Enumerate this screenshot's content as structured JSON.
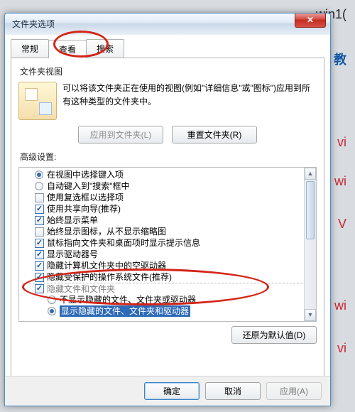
{
  "bg": {
    "t1": "win1(",
    "t2": "教",
    "t3": "vi",
    "t4": "wi",
    "t5": "V",
    "t6": "wi",
    "t7": "vi"
  },
  "dialog": {
    "title": "文件夹选项",
    "tabs": [
      "常规",
      "查看",
      "搜索"
    ],
    "sec_view": "文件夹视图",
    "view_desc": "可以将该文件夹正在使用的视图(例如\"详细信息\"或\"图标\")应用到所有这种类型的文件夹中。",
    "btn_apply_folders": "应用到文件夹(L)",
    "btn_reset_folders": "重置文件夹(R)",
    "sec_adv": "高级设置:",
    "items": [
      {
        "type": "radio",
        "sel": true,
        "label": "在视图中选择键入项"
      },
      {
        "type": "radio",
        "sel": false,
        "label": "自动键入到\"搜索\"框中"
      },
      {
        "type": "check",
        "sel": false,
        "label": "使用复选框以选择项"
      },
      {
        "type": "check",
        "sel": true,
        "label": "使用共享向导(推荐)"
      },
      {
        "type": "check",
        "sel": true,
        "label": "始终显示菜单"
      },
      {
        "type": "check",
        "sel": false,
        "label": "始终显示图标，从不显示缩略图"
      },
      {
        "type": "check",
        "sel": true,
        "label": "鼠标指向文件夹和桌面项时显示提示信息"
      },
      {
        "type": "check",
        "sel": true,
        "label": "显示驱动器号"
      },
      {
        "type": "check",
        "sel": true,
        "label": "隐藏计算机文件夹中的空驱动器"
      },
      {
        "type": "check",
        "sel": true,
        "label": "隐藏受保护的操作系统文件(推荐)"
      },
      {
        "type": "check",
        "sel": true,
        "label": "隐藏文件和文件夹",
        "dim": true
      },
      {
        "type": "radio",
        "sel": false,
        "label": "不显示隐藏的文件、文件夹或驱动器",
        "indent": true
      },
      {
        "type": "radio",
        "sel": true,
        "label": "显示隐藏的文件、文件夹和驱动器",
        "indent": true,
        "hl": true
      }
    ],
    "btn_restore": "还原为默认值(D)",
    "btn_ok": "确定",
    "btn_cancel": "取消",
    "btn_apply": "应用(A)"
  }
}
